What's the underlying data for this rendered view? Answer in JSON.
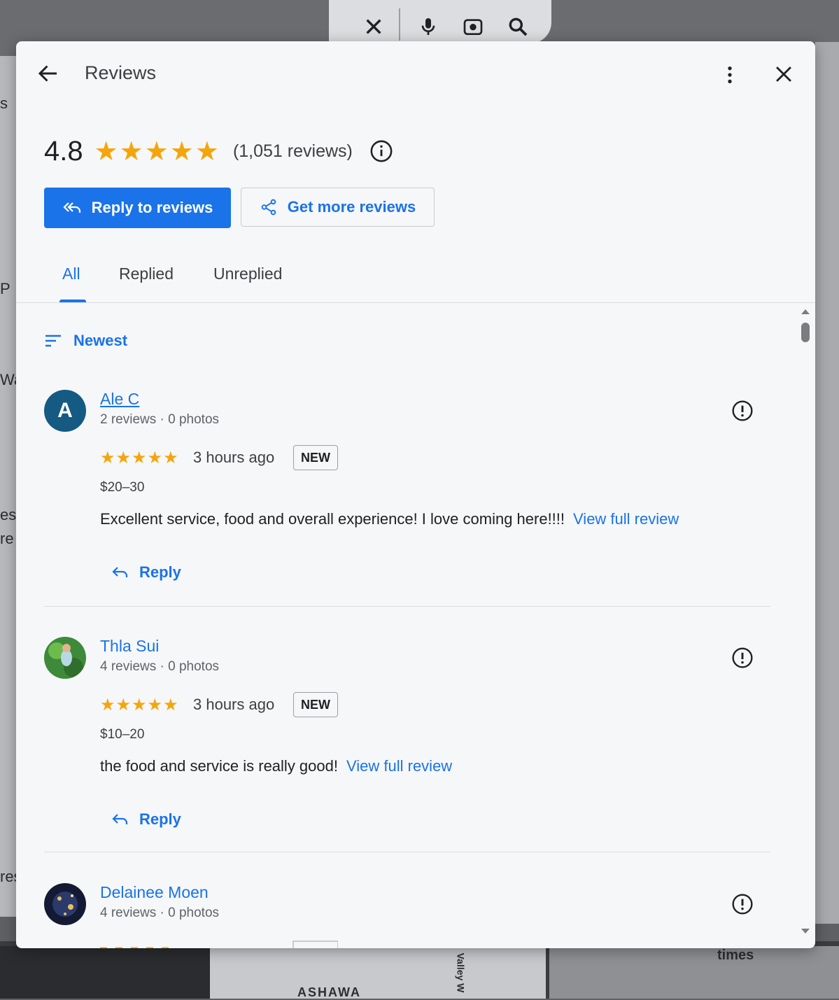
{
  "background": {
    "left_fragments": [
      "s",
      "P",
      "Wa",
      "es",
      "re",
      "res"
    ],
    "bottom_right_text": "times",
    "map_label": "ASHAWA",
    "map_street": "Valley W"
  },
  "header": {
    "title": "Reviews"
  },
  "summary": {
    "rating": "4.8",
    "stars": "★★★★★",
    "review_count": "(1,051 reviews)"
  },
  "actions": {
    "reply_label": "Reply to reviews",
    "get_more_label": "Get more reviews"
  },
  "tabs": [
    {
      "label": "All",
      "active": true
    },
    {
      "label": "Replied",
      "active": false
    },
    {
      "label": "Unreplied",
      "active": false
    }
  ],
  "sort": {
    "label": "Newest"
  },
  "reviews": [
    {
      "avatar_letter": "A",
      "name": "Ale C",
      "meta": "2 reviews · 0 photos",
      "stars": "★★★★★",
      "time": "3 hours ago",
      "badge": "NEW",
      "price": "$20–30",
      "text": "Excellent service, food and overall experience! I love coming here!!!!",
      "view_full": "View full review",
      "reply_label": "Reply"
    },
    {
      "avatar_letter": "",
      "name": "Thla Sui",
      "meta": "4 reviews · 0 photos",
      "stars": "★★★★★",
      "time": "3 hours ago",
      "badge": "NEW",
      "price": "$10–20",
      "text": "the food and service is really good!",
      "view_full": "View full review",
      "reply_label": "Reply"
    },
    {
      "avatar_letter": "",
      "name": "Delainee Moen",
      "meta": "4 reviews · 0 photos"
    }
  ],
  "colors": {
    "accent": "#1a73e8",
    "star": "#f5a50b",
    "avatar_letter_bg": "#145a83"
  }
}
